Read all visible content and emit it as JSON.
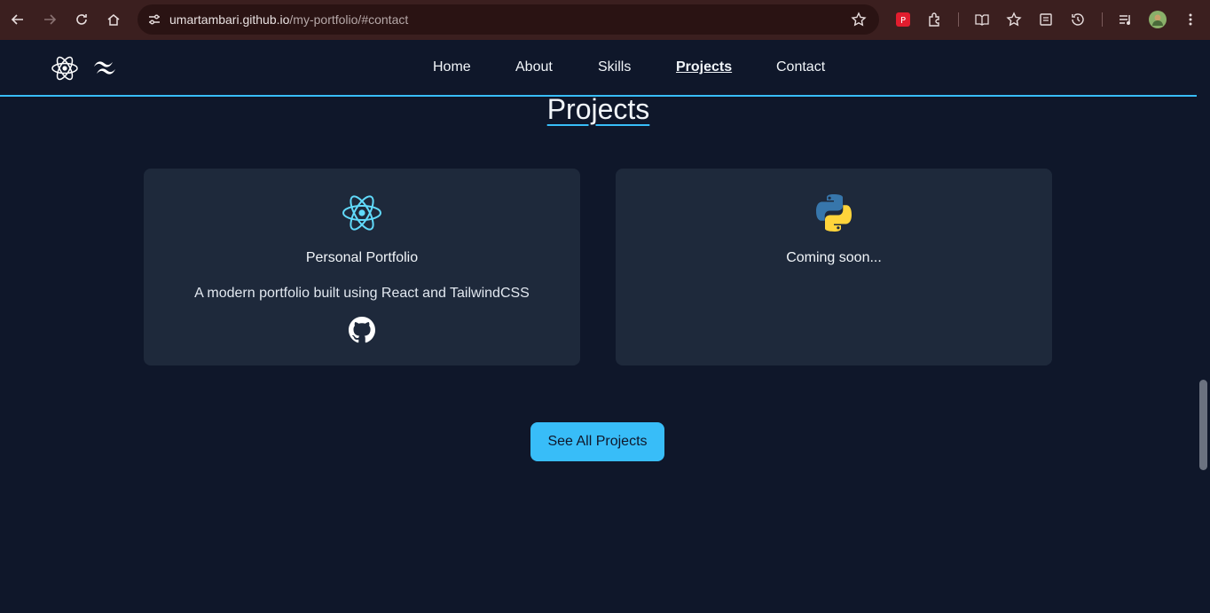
{
  "browser": {
    "url_host": "umartambari.github.io",
    "url_path": "/my-portfolio/#contact"
  },
  "nav": {
    "items": [
      {
        "label": "Home"
      },
      {
        "label": "About"
      },
      {
        "label": "Skills"
      },
      {
        "label": "Projects",
        "active": true
      },
      {
        "label": "Contact"
      }
    ]
  },
  "projects": {
    "title": "Projects",
    "cards": [
      {
        "icon": "react-icon",
        "title": "Personal Portfolio",
        "description": "A modern portfolio built using React and TailwindCSS",
        "link_icon": "github-icon"
      },
      {
        "icon": "python-icon",
        "title": "Coming soon..."
      }
    ],
    "see_all_label": "See All Projects"
  },
  "colors": {
    "background": "#0f172a",
    "card": "#1e293b",
    "accent": "#38bdf8",
    "chrome": "#3b1f1f"
  }
}
